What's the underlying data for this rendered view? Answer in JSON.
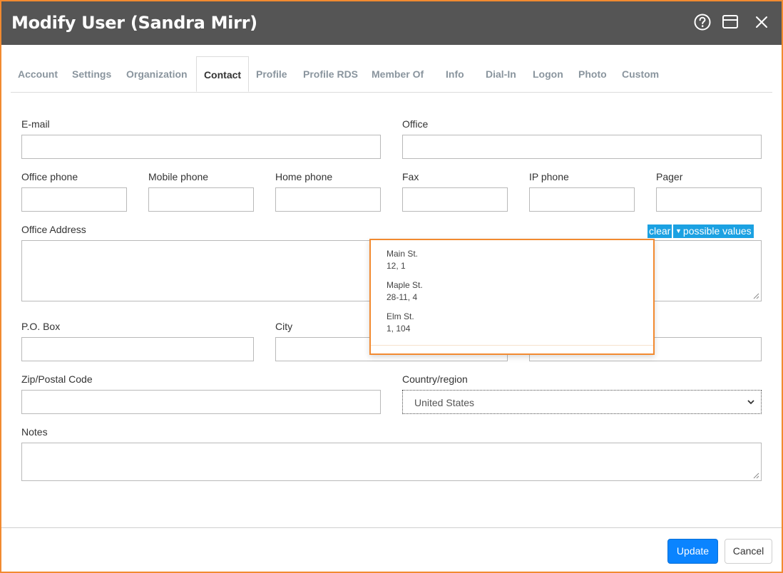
{
  "window": {
    "title": "Modify User (Sandra Mirr)",
    "accent_color": "#f28a30",
    "titlebar_color": "#555555",
    "icons": [
      "help-icon",
      "maximize-icon",
      "close-icon"
    ]
  },
  "tabs": [
    {
      "label": "Account",
      "active": false
    },
    {
      "label": "Settings",
      "active": false
    },
    {
      "label": "Organization",
      "active": false
    },
    {
      "label": "Contact",
      "active": true
    },
    {
      "label": "Profile",
      "active": false
    },
    {
      "label": "Profile RDS",
      "active": false
    },
    {
      "label": "Member Of",
      "active": false
    },
    {
      "label": "Info",
      "active": false
    },
    {
      "label": "Dial-In",
      "active": false
    },
    {
      "label": "Logon",
      "active": false
    },
    {
      "label": "Photo",
      "active": false
    },
    {
      "label": "Custom",
      "active": false
    }
  ],
  "fields": {
    "email": {
      "label": "E-mail",
      "value": ""
    },
    "office": {
      "label": "Office",
      "value": ""
    },
    "office_phone": {
      "label": "Office phone",
      "value": ""
    },
    "mobile_phone": {
      "label": "Mobile phone",
      "value": ""
    },
    "home_phone": {
      "label": "Home phone",
      "value": ""
    },
    "fax": {
      "label": "Fax",
      "value": ""
    },
    "ip_phone": {
      "label": "IP phone",
      "value": ""
    },
    "pager": {
      "label": "Pager",
      "value": ""
    },
    "office_address": {
      "label": "Office Address",
      "value": ""
    },
    "po_box": {
      "label": "P.O. Box",
      "value": ""
    },
    "city": {
      "label": "City",
      "value": ""
    },
    "state": {
      "value": ""
    },
    "zip": {
      "label": "Zip/Postal Code",
      "value": ""
    },
    "country": {
      "label": "Country/region",
      "value": "United States"
    },
    "notes": {
      "label": "Notes",
      "value": ""
    }
  },
  "address_helpers": {
    "clear_label": "clear",
    "possible_values_label": "possible values",
    "button_color": "#1ba1e2"
  },
  "possible_values": [
    {
      "line1": "Main St.",
      "line2": "12, 1"
    },
    {
      "line1": "Maple St.",
      "line2": "28-11, 4"
    },
    {
      "line1": "Elm St.",
      "line2": "1, 104"
    }
  ],
  "footer": {
    "update_label": "Update",
    "cancel_label": "Cancel",
    "update_color": "#0a84ff"
  }
}
